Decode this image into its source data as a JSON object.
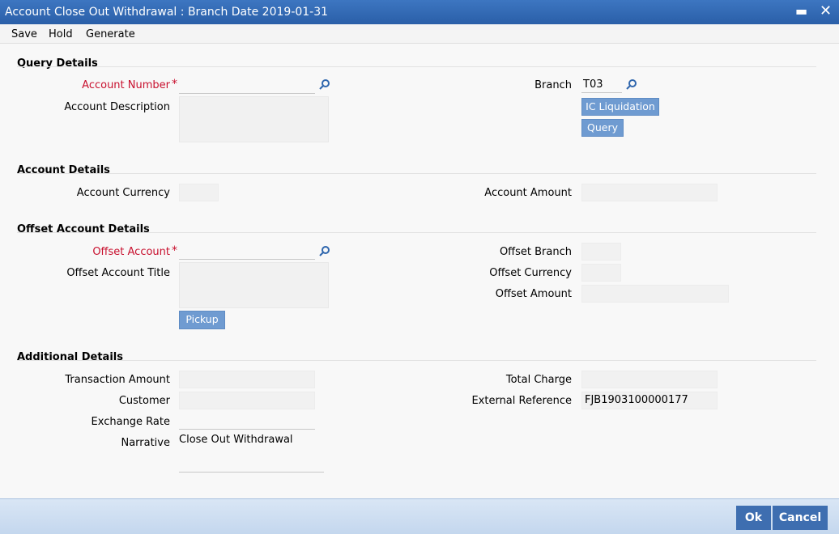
{
  "window": {
    "title": "Account Close Out Withdrawal : Branch Date 2019-01-31"
  },
  "menu": {
    "save": "Save",
    "hold": "Hold",
    "generate": "Generate"
  },
  "query_details": {
    "heading": "Query Details",
    "account_number_label": "Account Number",
    "account_number_value": "",
    "account_description_label": "Account Description",
    "branch_label": "Branch",
    "branch_value": "T03",
    "ic_liquidation_button": "IC Liquidation",
    "query_button": "Query"
  },
  "account_details": {
    "heading": "Account Details",
    "account_currency_label": "Account Currency",
    "account_currency_value": "",
    "account_amount_label": "Account Amount",
    "account_amount_value": ""
  },
  "offset_account_details": {
    "heading": "Offset Account Details",
    "offset_account_label": "Offset Account",
    "offset_account_value": "",
    "offset_account_title_label": "Offset Account Title",
    "pickup_button": "Pickup",
    "offset_branch_label": "Offset Branch",
    "offset_currency_label": "Offset Currency",
    "offset_amount_label": "Offset Amount"
  },
  "additional_details": {
    "heading": "Additional Details",
    "transaction_amount_label": "Transaction Amount",
    "customer_label": "Customer",
    "exchange_rate_label": "Exchange Rate",
    "narrative_label": "Narrative",
    "narrative_value": "Close Out Withdrawal",
    "total_charge_label": "Total Charge",
    "external_reference_label": "External Reference",
    "external_reference_value": "FJB1903100000177"
  },
  "footer": {
    "ok": "Ok",
    "cancel": "Cancel"
  },
  "required_marker": "*",
  "colors": {
    "title_bar": "#2f66ad",
    "button": "#6f9bd1",
    "required": "#c8102e",
    "footer_button": "#3e6eb0"
  },
  "icons": {
    "lookup": "search-icon",
    "minimize": "minimize-icon",
    "close": "close-icon"
  }
}
